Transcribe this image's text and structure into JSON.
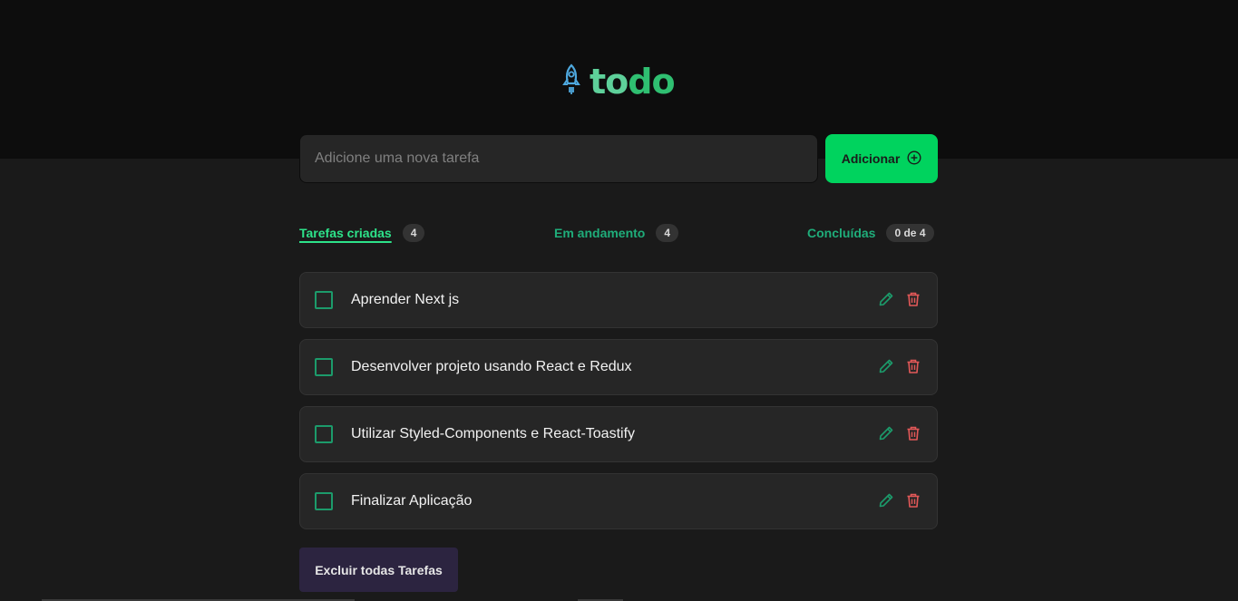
{
  "header": {
    "logo_icon": "rocket-icon",
    "logo_text_part1": "to",
    "logo_text_part2": "do"
  },
  "form": {
    "placeholder": "Adicione uma nova tarefa",
    "value": "",
    "add_label": "Adicionar",
    "add_icon": "plus-circle-icon"
  },
  "stats": {
    "created_label": "Tarefas criadas",
    "created_count": "4",
    "in_progress_label": "Em andamento",
    "in_progress_count": "4",
    "done_label": "Concluídas",
    "done_count": "0 de 4"
  },
  "tasks": [
    {
      "text": "Aprender Next js",
      "done": false
    },
    {
      "text": "Desenvolver projeto usando React e Redux",
      "done": false
    },
    {
      "text": "Utilizar Styled-Components e React-Toastify",
      "done": false
    },
    {
      "text": "Finalizar Aplicação",
      "done": false
    }
  ],
  "actions": {
    "delete_all_label": "Excluir todas Tarefas"
  },
  "colors": {
    "accent_green": "#00d35e",
    "edit_green": "#1c9b6b",
    "delete_red": "#e25858",
    "delete_all_bg": "#2c2440"
  }
}
